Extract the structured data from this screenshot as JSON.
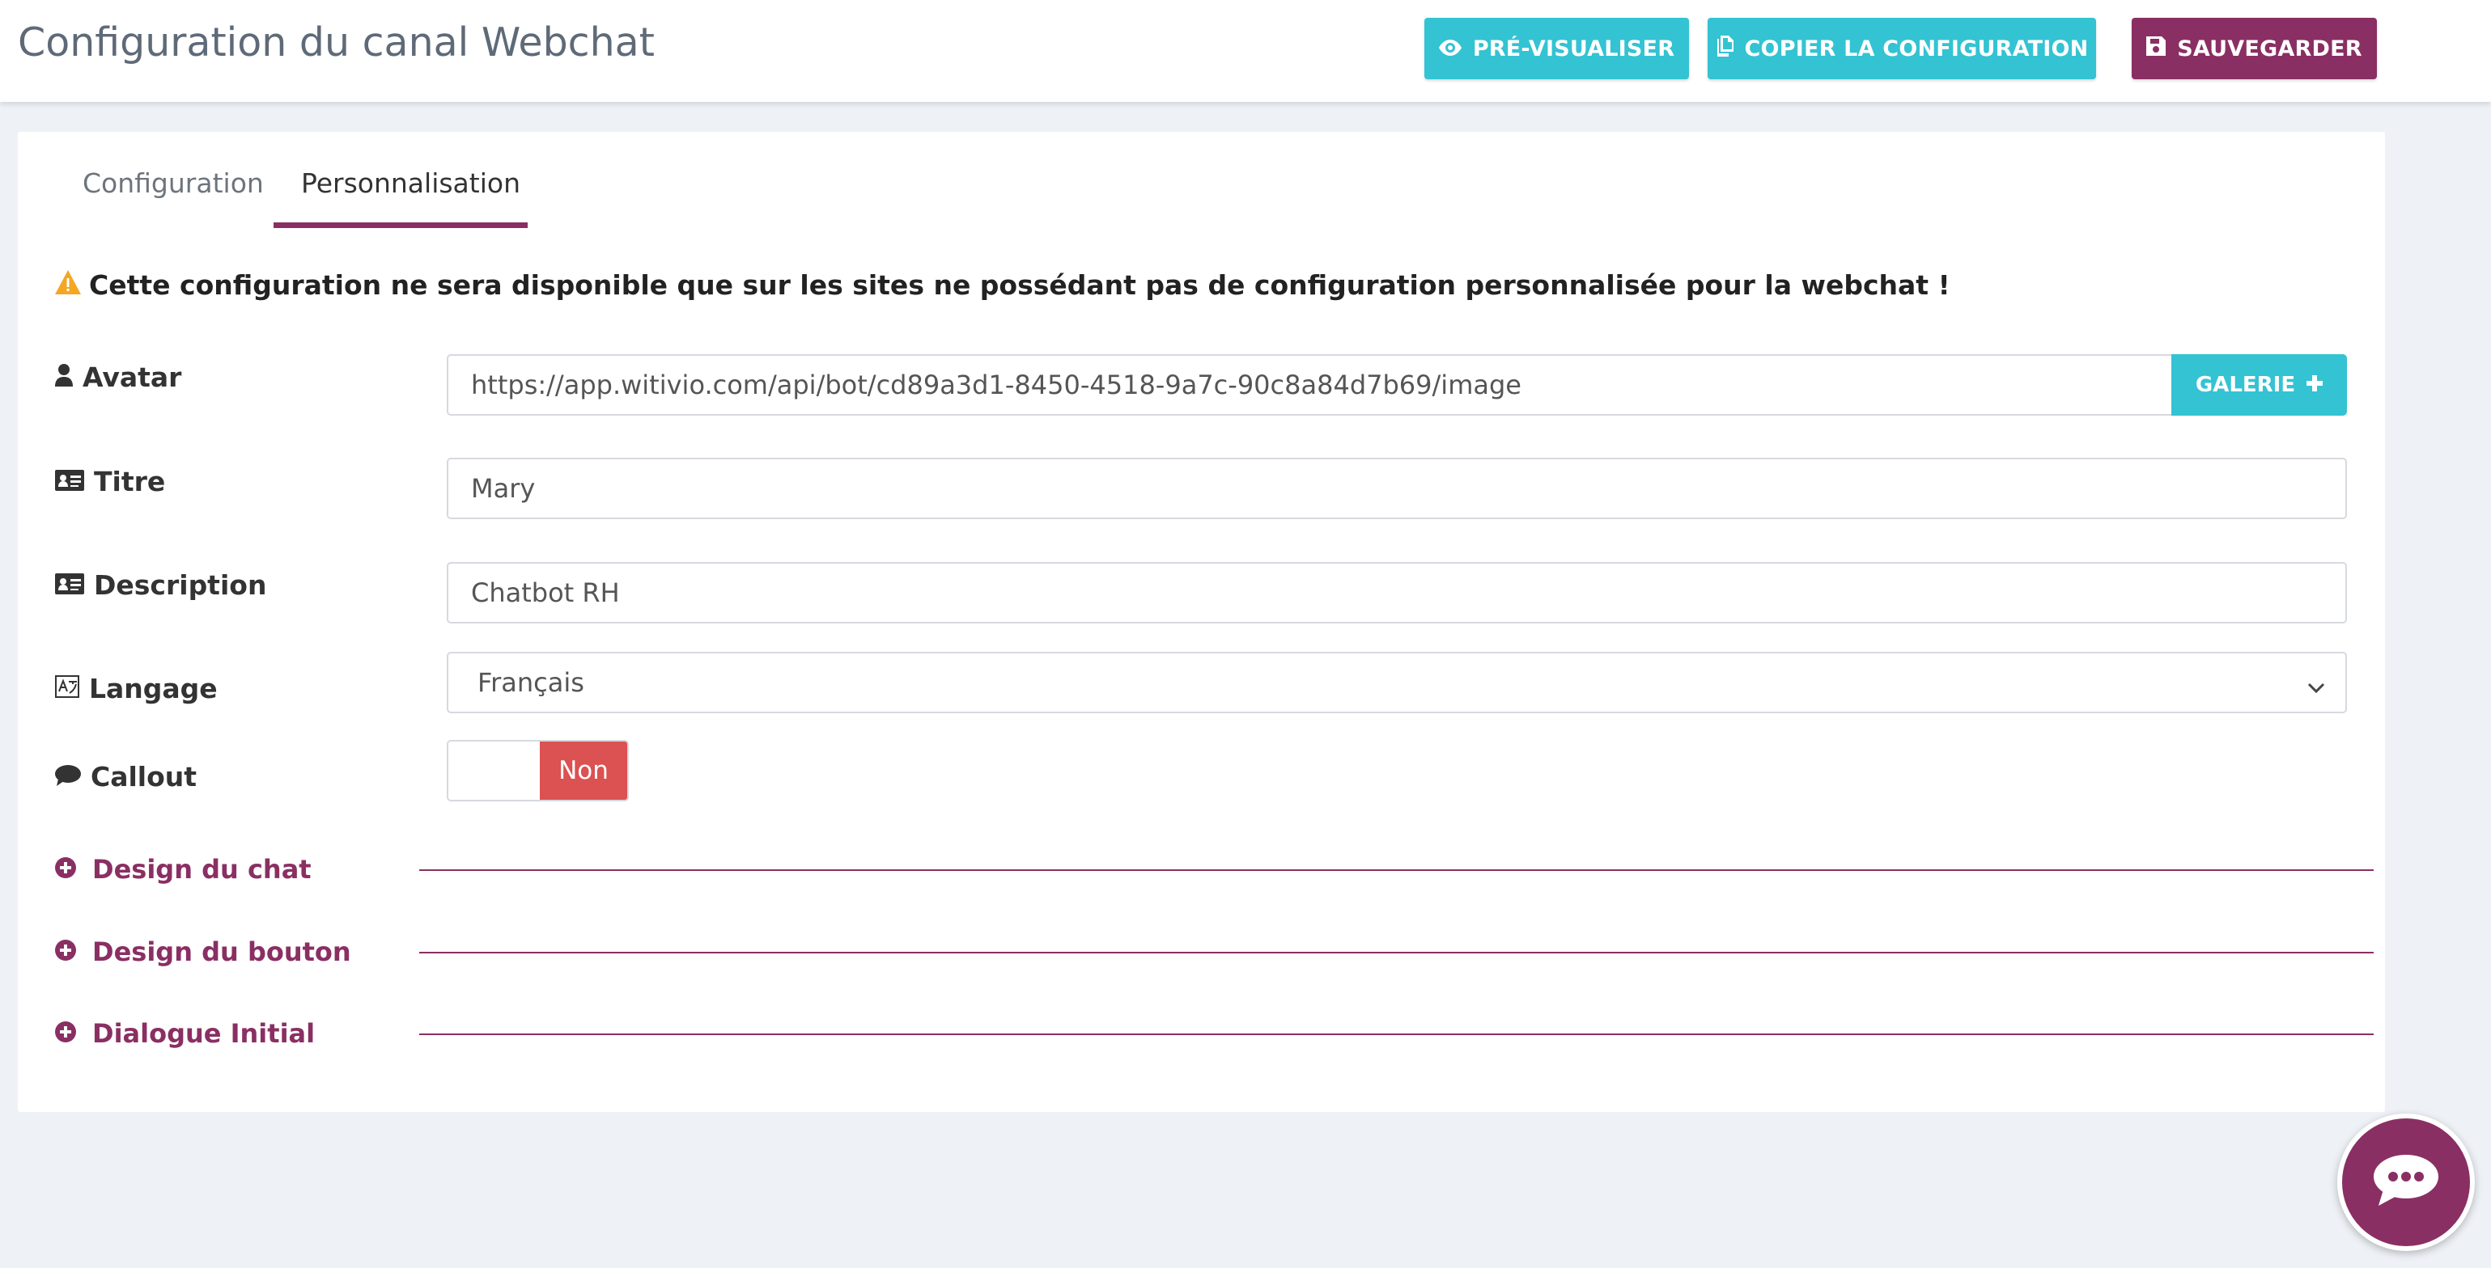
{
  "header": {
    "title": "Configuration du canal Webchat",
    "preview_label": "PRÉ-VISUALISER",
    "copy_label": "COPIER LA CONFIGURATION",
    "save_label": "SAUVEGARDER"
  },
  "tabs": [
    {
      "label": "Configuration",
      "active": false
    },
    {
      "label": "Personnalisation",
      "active": true
    }
  ],
  "warning": "Cette configuration ne sera disponible que sur les sites ne possédant pas de configuration personnalisée pour la webchat !",
  "form": {
    "avatar": {
      "label": "Avatar",
      "value": "https://app.witivio.com/api/bot/cd89a3d1-8450-4518-9a7c-90c8a84d7b69/image",
      "button_label": "GALERIE"
    },
    "titre": {
      "label": "Titre",
      "value": "Mary"
    },
    "description": {
      "label": "Description",
      "value": "Chatbot RH"
    },
    "langage": {
      "label": "Langage",
      "value": "Français"
    },
    "callout": {
      "label": "Callout",
      "state": "Non"
    }
  },
  "sections": [
    {
      "label": "Design du chat"
    },
    {
      "label": "Design du bouton"
    },
    {
      "label": "Dialogue Initial"
    }
  ],
  "colors": {
    "teal": "#33c3d3",
    "plum": "#8a2f63",
    "toggle_off": "#dc5151",
    "warning": "#f5a623"
  },
  "icons": {
    "preview": "eye-icon",
    "copy": "copy-icon",
    "save": "floppy-disk-icon",
    "warning": "warning-triangle-icon",
    "avatar": "user-icon",
    "titre": "id-card-icon",
    "description": "id-card-icon",
    "langage": "language-icon",
    "callout": "speech-bubble-icon",
    "section": "plus-circle-icon",
    "fab": "chat-bubble-icon"
  }
}
